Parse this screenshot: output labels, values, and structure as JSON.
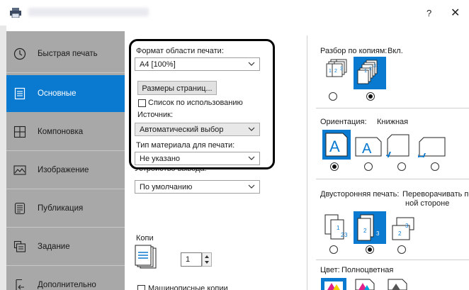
{
  "window": {
    "help": "?",
    "close": "✕"
  },
  "sidebar": {
    "items": [
      {
        "label": "Быстрая печать",
        "icon": "clock-icon"
      },
      {
        "label": "Основные",
        "icon": "document-icon",
        "active": true
      },
      {
        "label": "Компоновка",
        "icon": "layout-grid-icon"
      },
      {
        "label": "Изображение",
        "icon": "image-icon"
      },
      {
        "label": "Публикация",
        "icon": "publication-icon"
      },
      {
        "label": "Задание",
        "icon": "job-stack-icon"
      },
      {
        "label": "Дополнительно",
        "icon": "advanced-icon"
      }
    ]
  },
  "basic": {
    "paper_size_label": "Формат области печати:",
    "paper_size_value": "A4  [100%]",
    "page_sizes_button": "Размеры страниц...",
    "list_by_usage": "Список по использованию",
    "source_label": "Источник:",
    "source_value": "Автоматический выбор",
    "media_type_label": "Тип материала для печати:",
    "media_type_value": "Не указано",
    "output_label": "Устройство вывода:",
    "output_value": "По умолчанию",
    "copies_label": "Копи",
    "copies_value": "1",
    "collate_footer": "Машинописные копии"
  },
  "right": {
    "collate_label": "Разбор по копиям:",
    "collate_value": "Вкл.",
    "orientation_label": "Ориентация:",
    "orientation_value": "Книжная",
    "duplex_label": "Двусторонняя печать:",
    "duplex_value_line1": "Переворачивать по",
    "duplex_value_line2": "ной стороне",
    "color_label": "Цвет:",
    "color_value": "Полноцветная"
  },
  "colors": {
    "accent": "#0a7ad1",
    "sidebar": "#a8a8a8"
  }
}
